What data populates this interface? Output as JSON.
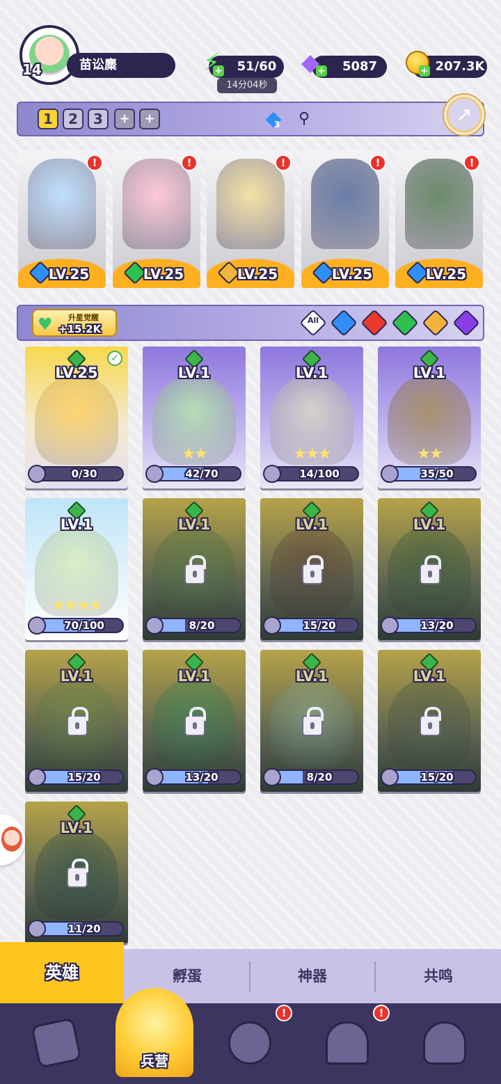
{
  "player": {
    "level": "14",
    "name": "苗讼麋"
  },
  "resources": {
    "energy": "51/60",
    "energy_timer": "14分04秒",
    "gems": "5087",
    "coins": "207.3K"
  },
  "team": {
    "tabs": [
      "1",
      "2",
      "3"
    ],
    "active_tab": "1",
    "add_slots": [
      "+",
      "+"
    ],
    "gem_count": "3"
  },
  "lineup": [
    {
      "level": "LV.25",
      "element": "water",
      "color": "#2f8ff5",
      "art": "#bfe0ff",
      "alert": "!"
    },
    {
      "level": "LV.25",
      "element": "nature",
      "color": "#2fbf4f",
      "art": "#ffc8d8",
      "alert": "!"
    },
    {
      "level": "LV.25",
      "element": "light",
      "color": "#f2b53a",
      "art": "#f4e2a6",
      "alert": "!"
    },
    {
      "level": "LV.25",
      "element": "water",
      "color": "#2f8ff5",
      "art": "#6a7ea8",
      "alert": "!"
    },
    {
      "level": "LV.25",
      "element": "water",
      "color": "#2f8ff5",
      "art": "#6c8c6a",
      "alert": "!"
    }
  ],
  "filter": {
    "awaken_title": "升星觉醒",
    "awaken_value": "+15.2K",
    "all_label": "All",
    "elements": [
      {
        "name": "water",
        "color": "#2f8ff5"
      },
      {
        "name": "fire",
        "color": "#e8392c"
      },
      {
        "name": "nature",
        "color": "#2fbf4f"
      },
      {
        "name": "light",
        "color": "#f2b53a"
      },
      {
        "name": "dark",
        "color": "#8a3ee8"
      }
    ]
  },
  "heroes": [
    {
      "level": "LV.25",
      "progress": "0/30",
      "fraction": 0.0,
      "stars": "",
      "locked": false,
      "style": "owned-gold",
      "art": "#ffd36b",
      "checked": true
    },
    {
      "level": "LV.1",
      "progress": "42/70",
      "fraction": 0.6,
      "stars": "★★",
      "locked": false,
      "style": "owned-purple",
      "art": "#b5e3b0",
      "checked": false
    },
    {
      "level": "LV.1",
      "progress": "14/100",
      "fraction": 0.14,
      "stars": "★★★",
      "locked": false,
      "style": "owned-purple",
      "art": "#d9d6c8",
      "checked": false
    },
    {
      "level": "LV.1",
      "progress": "35/50",
      "fraction": 0.7,
      "stars": "★★",
      "locked": false,
      "style": "owned-purple",
      "art": "#a89064",
      "checked": false
    },
    {
      "level": "LV.1",
      "progress": "70/100",
      "fraction": 0.7,
      "stars": "★★★★",
      "locked": false,
      "style": "owned-blue",
      "art": "#d8eec0",
      "checked": false
    },
    {
      "level": "LV.1",
      "progress": "8/20",
      "fraction": 0.4,
      "stars": "",
      "locked": true,
      "style": "locked",
      "art": "#4e7a46",
      "checked": false
    },
    {
      "level": "LV.1",
      "progress": "15/20",
      "fraction": 0.75,
      "stars": "",
      "locked": true,
      "style": "locked",
      "art": "#5a3a3a",
      "checked": false
    },
    {
      "level": "LV.1",
      "progress": "13/20",
      "fraction": 0.65,
      "stars": "",
      "locked": true,
      "style": "locked",
      "art": "#2f5a3a",
      "checked": false
    },
    {
      "level": "LV.1",
      "progress": "15/20",
      "fraction": 0.75,
      "stars": "",
      "locked": true,
      "style": "locked",
      "art": "#6a8a4a",
      "checked": false
    },
    {
      "level": "LV.1",
      "progress": "13/20",
      "fraction": 0.65,
      "stars": "",
      "locked": true,
      "style": "locked",
      "art": "#2f8a5a",
      "checked": false
    },
    {
      "level": "LV.1",
      "progress": "8/20",
      "fraction": 0.4,
      "stars": "",
      "locked": true,
      "style": "locked",
      "art": "#8ab0a0",
      "checked": false
    },
    {
      "level": "LV.1",
      "progress": "15/20",
      "fraction": 0.75,
      "stars": "",
      "locked": true,
      "style": "locked",
      "art": "#4a5a4a",
      "checked": false
    },
    {
      "level": "LV.1",
      "progress": "11/20",
      "fraction": 0.55,
      "stars": "",
      "locked": true,
      "style": "locked",
      "art": "#1f4a4a",
      "checked": false
    }
  ],
  "subtabs": [
    "英雄",
    "孵蛋",
    "神器",
    "共鸣"
  ],
  "nav": {
    "items": [
      "cards-icon",
      "barracks-icon",
      "map-icon",
      "temple-icon",
      "mushroom-icon"
    ],
    "active_label": "兵营",
    "alerts": [
      "!",
      "!"
    ]
  }
}
